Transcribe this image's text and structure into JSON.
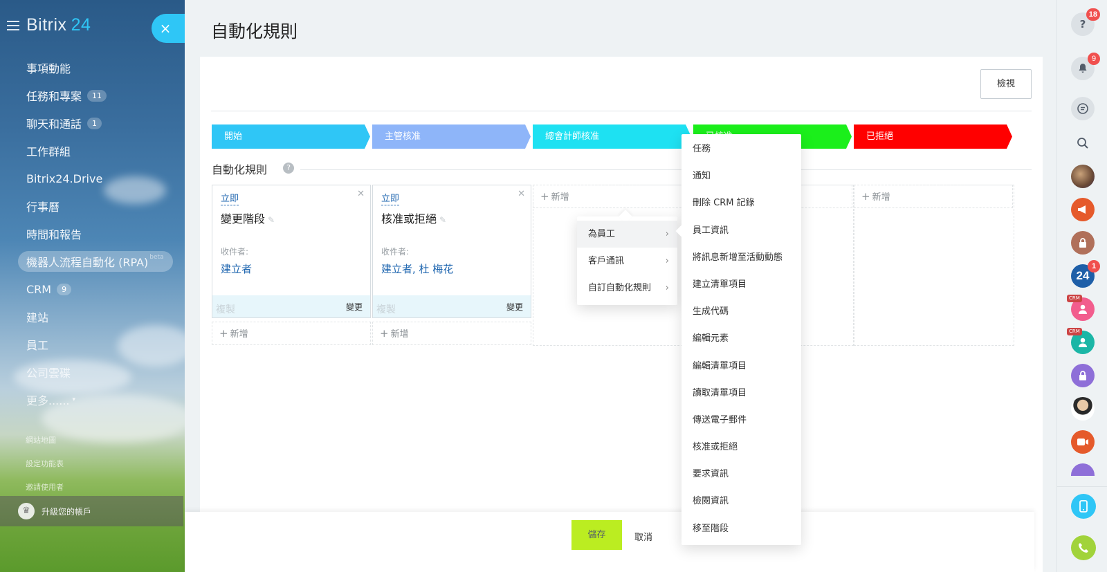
{
  "sidebar": {
    "logo": "Bitrix",
    "logo_num": "24",
    "close_icon": "×",
    "items": [
      {
        "label": "事項動能",
        "count": ""
      },
      {
        "label": "任務和專案",
        "count": "11"
      },
      {
        "label": "聊天和通話",
        "count": "1"
      },
      {
        "label": "工作群組",
        "count": ""
      },
      {
        "label": "Bitrix24.Drive",
        "count": ""
      },
      {
        "label": "行事曆",
        "count": ""
      },
      {
        "label": "時間和報告",
        "count": ""
      },
      {
        "label": "機器人流程自動化 (RPA)",
        "count": "",
        "tag": "beta"
      },
      {
        "label": "CRM",
        "count": "9"
      },
      {
        "label": "建站",
        "count": ""
      },
      {
        "label": "員工",
        "count": ""
      },
      {
        "label": "公司雲碟",
        "count": ""
      },
      {
        "label": "更多......",
        "count": ""
      }
    ],
    "small_links": [
      "網站地圖",
      "設定功能表",
      "邀請使用者"
    ],
    "upgrade_label": "升級您的帳戶"
  },
  "header": {
    "title": "自動化規則",
    "view_button": "檢視"
  },
  "stages": [
    {
      "label": "開始",
      "color": "#2fc6f6"
    },
    {
      "label": "主管核准",
      "color": "#8eb5f9"
    },
    {
      "label": "總會計師核准",
      "color": "#1ee1f2"
    },
    {
      "label": "已核准",
      "color": "#1bef1b"
    },
    {
      "label": "已拒絕",
      "color": "#ff0000"
    }
  ],
  "section": {
    "title": "自動化規則",
    "help_icon": "?"
  },
  "cards": [
    {
      "when": "立即",
      "title": "變更階段",
      "recipient_label": "收件者:",
      "recipient": "建立者",
      "copy": "複製",
      "change": "變更"
    },
    {
      "when": "立即",
      "title": "核准或拒絕",
      "recipient_label": "收件者:",
      "recipient": "建立者, 杜 梅花",
      "copy": "複製",
      "change": "變更"
    }
  ],
  "add_label": "新增",
  "submenu": {
    "items": [
      {
        "label": "為員工"
      },
      {
        "label": "客戶通訊"
      },
      {
        "label": "自訂自動化規則"
      }
    ]
  },
  "actions": [
    "任務",
    "通知",
    "刪除 CRM 記錄",
    "員工資訊",
    "將訊息新增至活動動態",
    "建立清單項目",
    "生成代碼",
    "編輯元素",
    "編輯清單項目",
    "讀取清單項目",
    "傳送電子郵件",
    "核准或拒絕",
    "要求資訊",
    "檢閱資訊",
    "移至階段"
  ],
  "footer": {
    "save": "儲存",
    "cancel": "取消"
  },
  "rightbar": {
    "help_badge": "18",
    "bell_badge": "9",
    "b24_label": "24",
    "b24_badge": "1",
    "crm_tag": "CRM"
  }
}
